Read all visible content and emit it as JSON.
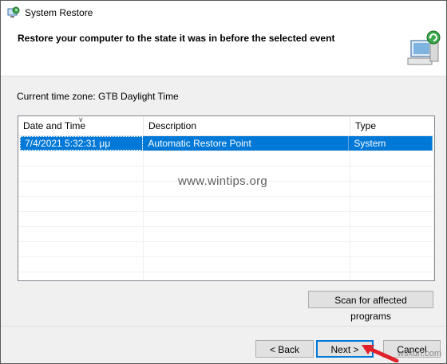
{
  "window": {
    "title": "System Restore"
  },
  "header": {
    "heading": "Restore your computer to the state it was in before the selected event"
  },
  "timezone_label": "Current time zone: GTB Daylight Time",
  "table": {
    "columns": [
      "Date and Time",
      "Description",
      "Type"
    ],
    "rows": [
      {
        "date": "7/4/2021 5:32:31 μμ",
        "description": "Automatic Restore Point",
        "type": "System",
        "selected": true
      }
    ]
  },
  "watermark": "www.wintips.org",
  "buttons": {
    "scan": "Scan for affected programs",
    "back": "< Back",
    "next": "Next >",
    "cancel": "Cancel"
  },
  "corner_watermark": "wsxdn.com",
  "colors": {
    "selection": "#0078d7",
    "arrow": "#e0202a"
  },
  "icons": [
    "system-restore-icon",
    "computer-restore-icon",
    "sort-arrow-icon",
    "pointer-arrow-icon"
  ]
}
